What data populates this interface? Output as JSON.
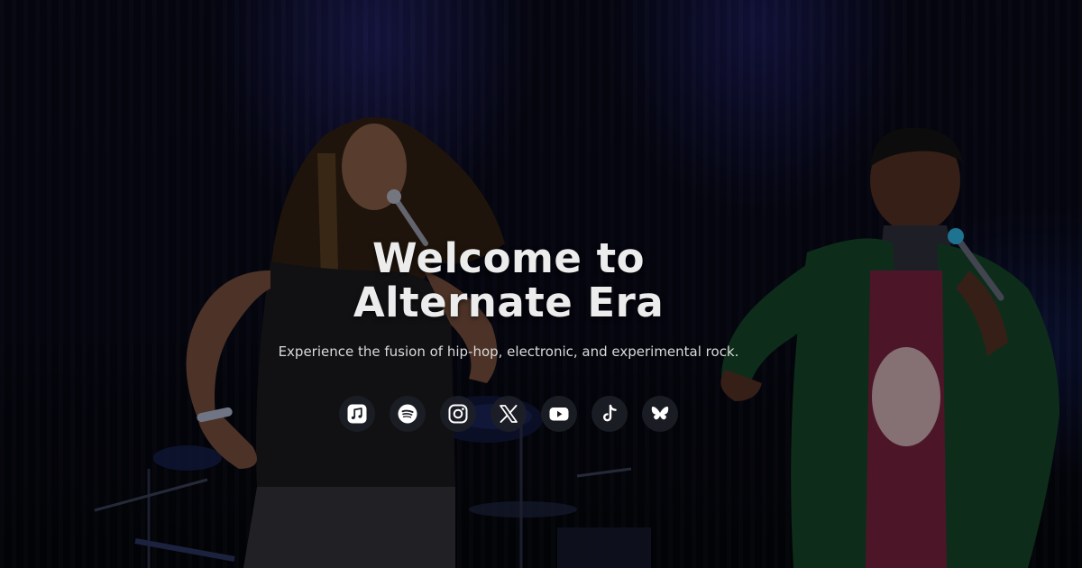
{
  "hero": {
    "title_line1": "Welcome to",
    "title_line2": "Alternate Era",
    "tagline": "Experience the fusion of hip-hop, electronic, and experimental rock."
  },
  "socials": [
    {
      "label": "Apple Music",
      "icon": "apple-music-icon"
    },
    {
      "label": "Spotify",
      "icon": "spotify-icon"
    },
    {
      "label": "Instagram",
      "icon": "instagram-icon"
    },
    {
      "label": "X",
      "icon": "x-icon"
    },
    {
      "label": "YouTube",
      "icon": "youtube-icon"
    },
    {
      "label": "TikTok",
      "icon": "tiktok-icon"
    },
    {
      "label": "Bluesky",
      "icon": "bluesky-icon"
    }
  ],
  "colors": {
    "title": "#ececec",
    "tagline": "#dadada",
    "icon_bg": "#1c1e26",
    "icon_fg": "#ffffff",
    "stage_light": "#2d2d8c"
  }
}
